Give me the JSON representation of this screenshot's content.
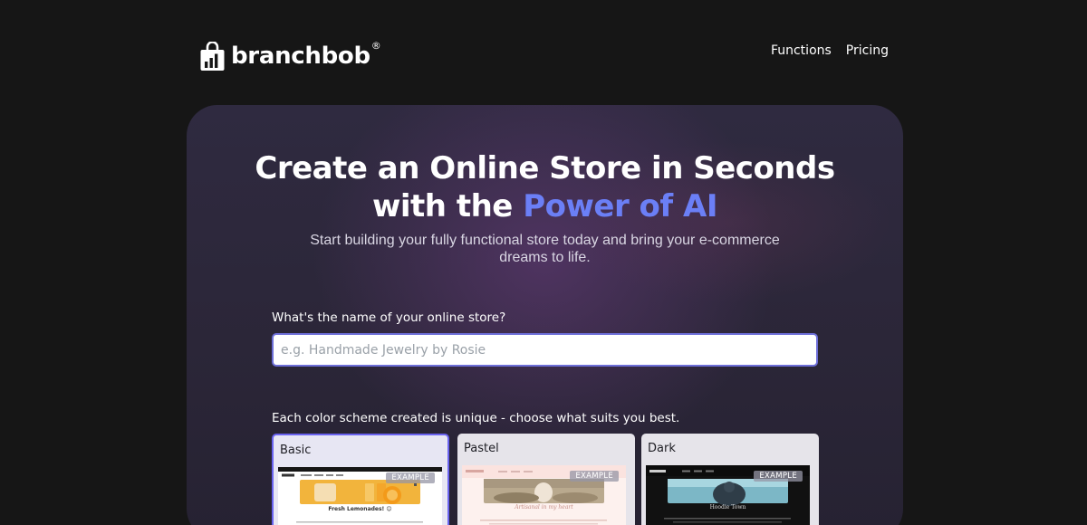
{
  "brand": {
    "name": "branchbob",
    "registered": "®"
  },
  "nav": {
    "items": [
      "Functions",
      "Pricing"
    ]
  },
  "hero": {
    "title_line1": "Create an Online Store in Seconds",
    "title_line2_prefix": "with the ",
    "title_line2_accent": "Power of AI",
    "subtitle": "Start building your fully functional store today and bring your e-commerce dreams to life."
  },
  "store_name": {
    "label": "What's the name of your online store?",
    "placeholder": "e.g. Handmade Jewelry by Rosie",
    "value": ""
  },
  "color_schemes": {
    "label": "Each color scheme created is unique - choose what suits you best.",
    "badge": "EXAMPLE",
    "options": [
      {
        "name": "Basic",
        "selected": true,
        "preview_text": "Fresh Lemonades! 😊"
      },
      {
        "name": "Pastel",
        "selected": false,
        "preview_text": "Artisanal in my heart"
      },
      {
        "name": "Dark",
        "selected": false,
        "preview_text": "Hoodie Town"
      }
    ]
  },
  "colors": {
    "background": "#161616",
    "accent": "#6b7ff6",
    "input_border": "#6d6fd8",
    "selected_border": "#6a63f0"
  }
}
